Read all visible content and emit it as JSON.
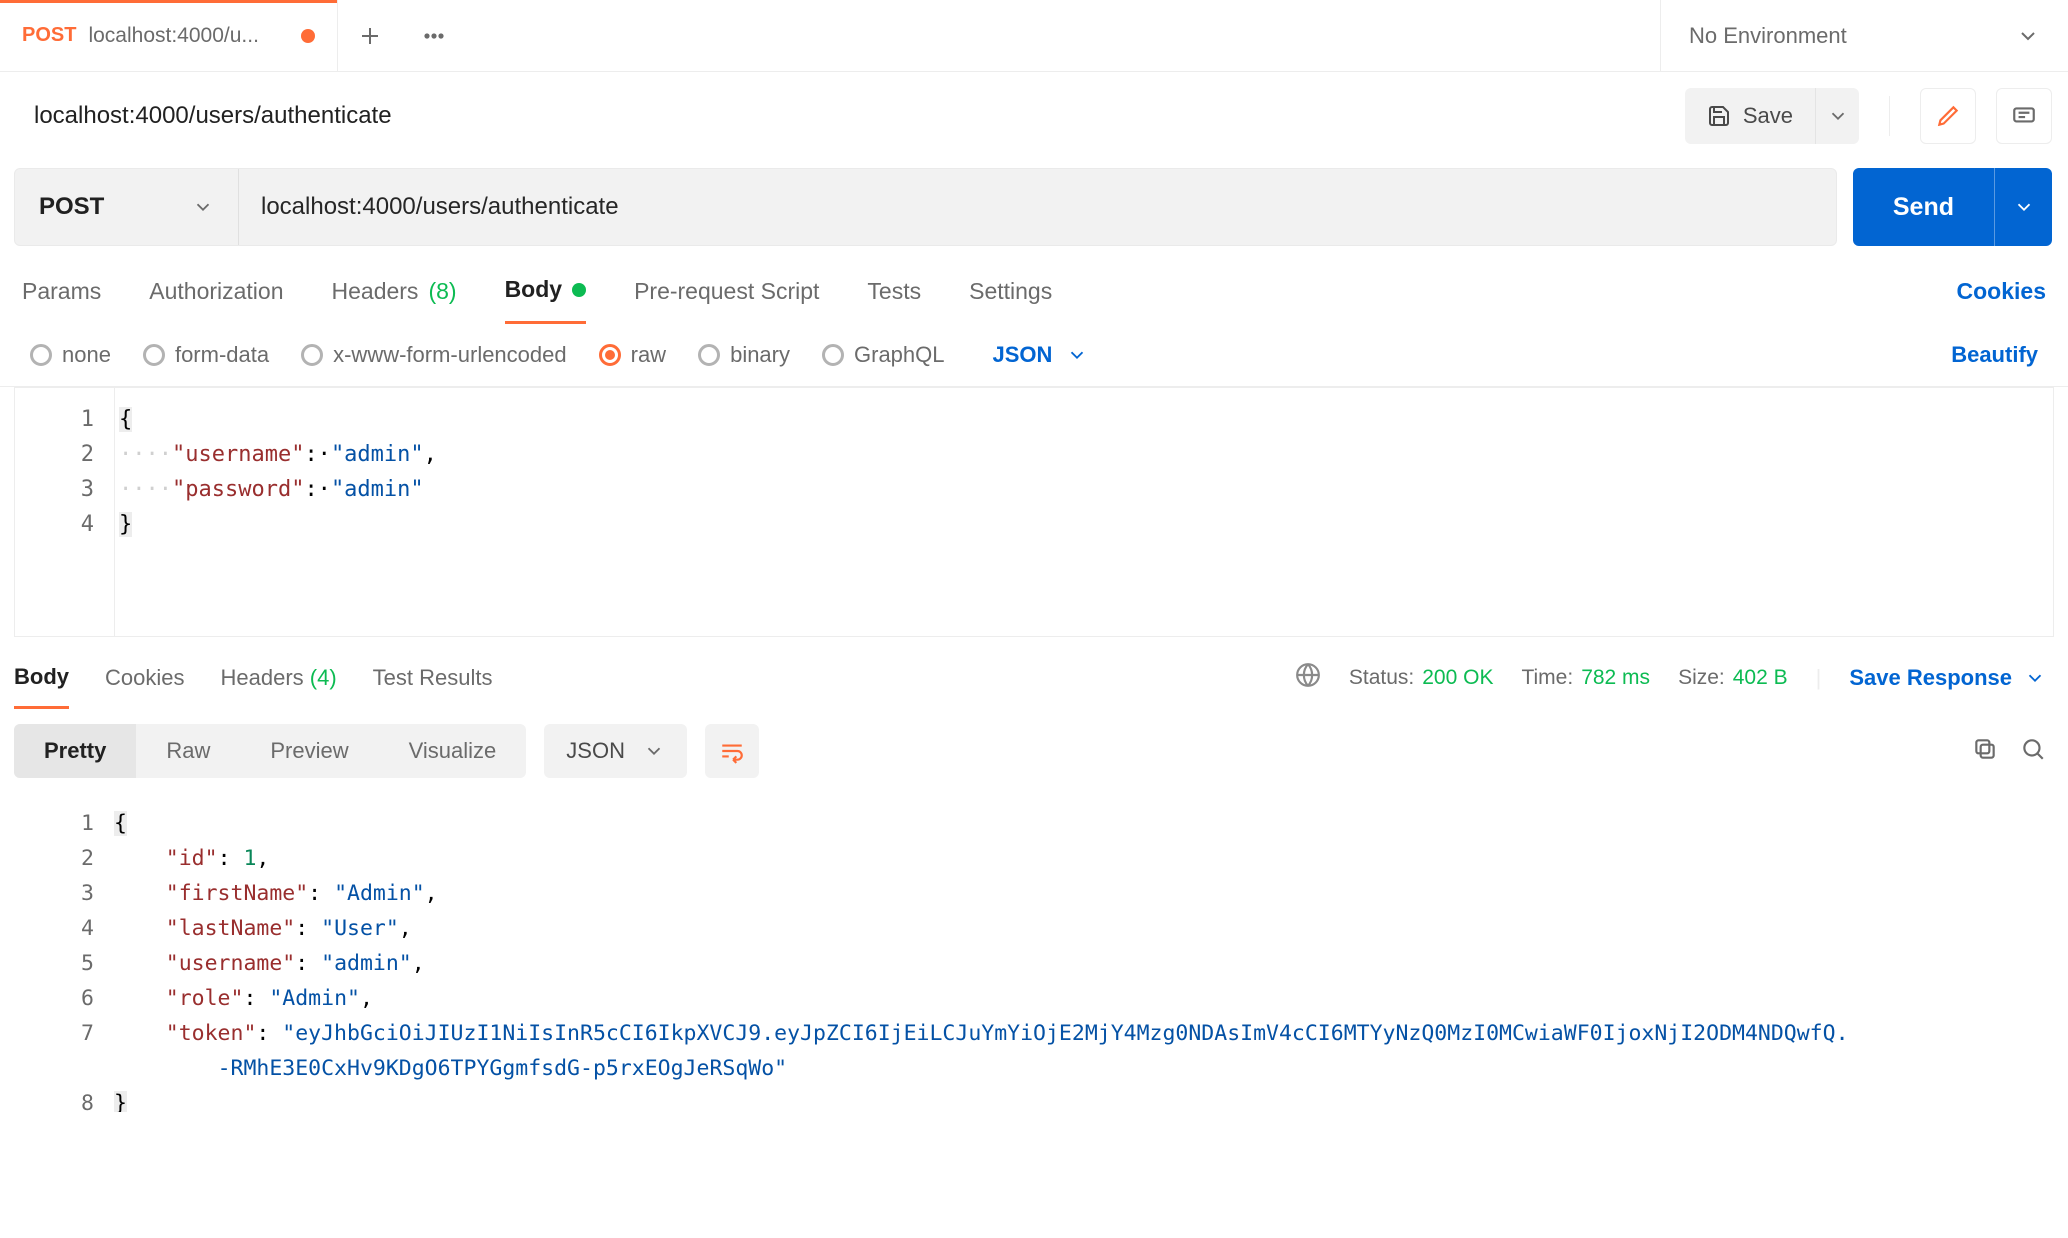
{
  "tab": {
    "method": "POST",
    "title": "localhost:4000/u..."
  },
  "env": {
    "label": "No Environment"
  },
  "title": "localhost:4000/users/authenticate",
  "actions": {
    "save": "Save"
  },
  "request": {
    "method": "POST",
    "url": "localhost:4000/users/authenticate",
    "send": "Send",
    "tabs": {
      "params": "Params",
      "auth": "Authorization",
      "headers": "Headers",
      "headers_count": "(8)",
      "body": "Body",
      "pre": "Pre-request Script",
      "tests": "Tests",
      "settings": "Settings",
      "cookies": "Cookies"
    },
    "body_radios": {
      "none": "none",
      "form": "form-data",
      "xwww": "x-www-form-urlencoded",
      "raw": "raw",
      "binary": "binary",
      "gql": "GraphQL"
    },
    "lang": "JSON",
    "beautify": "Beautify",
    "body_lines": {
      "l1": "{",
      "l2_ws": "····",
      "l2_k": "\"username\"",
      "l2_c": ":·",
      "l2_v": "\"admin\"",
      "l2_e": ",",
      "l3_ws": "····",
      "l3_k": "\"password\"",
      "l3_c": ":·",
      "l3_v": "\"admin\"",
      "l4": "}"
    }
  },
  "response": {
    "tabs": {
      "body": "Body",
      "cookies": "Cookies",
      "headers": "Headers",
      "headers_count": "(4)",
      "tests": "Test Results"
    },
    "meta": {
      "status_l": "Status:",
      "status_v": "200 OK",
      "time_l": "Time:",
      "time_v": "782 ms",
      "size_l": "Size:",
      "size_v": "402 B"
    },
    "save": "Save Response",
    "views": {
      "pretty": "Pretty",
      "raw": "Raw",
      "preview": "Preview",
      "visualize": "Visualize"
    },
    "format": "JSON",
    "lines": {
      "l1": "{",
      "l2_k": "\"id\"",
      "l2_v": "1",
      "l3_k": "\"firstName\"",
      "l3_v": "\"Admin\"",
      "l4_k": "\"lastName\"",
      "l4_v": "\"User\"",
      "l5_k": "\"username\"",
      "l5_v": "\"admin\"",
      "l6_k": "\"role\"",
      "l6_v": "\"Admin\"",
      "l7_k": "\"token\"",
      "l7_v": "\"eyJhbGciOiJIUzI1NiIsInR5cCI6IkpXVCJ9.eyJpZCI6IjEiLCJuYmYiOjE2MjY4Mzg0NDAsImV4cCI6MTYyNzQ0MzI0MCwiaWF0IjoxNjI2ODM4NDQwfQ.",
      "l7_v2": "-RMhE3E0CxHv9KDgO6TPYGgmfsdG-p5rxEOgJeRSqWo\"",
      "l8": "}"
    }
  }
}
